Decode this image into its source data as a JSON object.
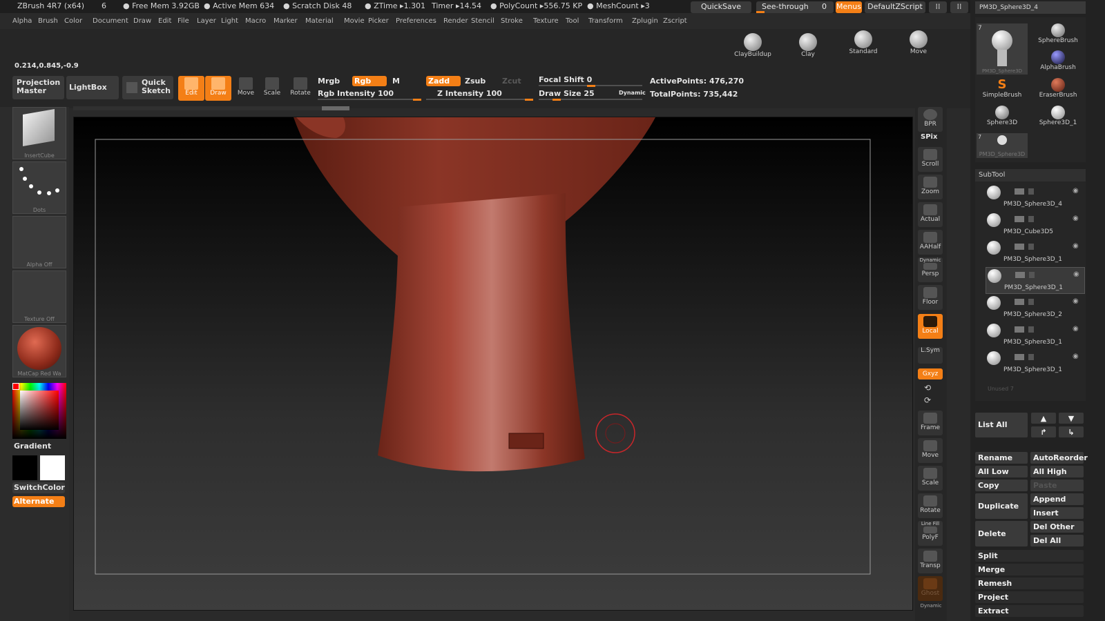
{
  "title_bar": {
    "app": "ZBrush 4R7 (x64)",
    "num": "6",
    "free_mem": "● Free Mem 3.92GB",
    "active_mem": "● Active Mem 634",
    "scratch": "● Scratch Disk 48",
    "ztime": "● ZTime ▸1.301",
    "timer": "Timer ▸14.54",
    "polycount": "● PolyCount ▸556.75 KP",
    "meshcount": "● MeshCount ▸3",
    "quicksave": "QuickSave",
    "see_through": "See-through",
    "see_through_val": "0",
    "menus": "Menus",
    "default_zscript": "DefaultZScript"
  },
  "menu_items": [
    "Alpha",
    "Brush",
    "Color",
    "Document",
    "Draw",
    "Edit",
    "File",
    "Layer",
    "Light",
    "Macro",
    "Marker",
    "Material",
    "Movie",
    "Picker",
    "Preferences",
    "Render",
    "Stencil",
    "Stroke",
    "Texture",
    "Tool",
    "Transform",
    "Zplugin",
    "Zscript"
  ],
  "shelf": {
    "coords": "0.214,0.845,-0.9",
    "projection_master": [
      "Projection",
      "Master"
    ],
    "lightbox": "LightBox",
    "quick_sketch": [
      "Quick",
      "Sketch"
    ],
    "edit": "Edit",
    "draw": "Draw",
    "move": "Move",
    "scale": "Scale",
    "rotate": "Rotate",
    "mrgb": "Mrgb",
    "rgb": "Rgb",
    "m": "M",
    "rgb_intensity": "Rgb  Intensity 100",
    "zadd": "Zadd",
    "zsub": "Zsub",
    "zcut": "Zcut",
    "z_intensity": "Z  Intensity 100",
    "focal_shift": "Focal  Shift 0",
    "draw_size": "Draw  Size 25",
    "dynamic": "Dynamic",
    "active_points": "ActivePoints: 476,270",
    "total_points": "TotalPoints: 735,442",
    "brushes": [
      "ClayBuildup",
      "Clay",
      "Standard",
      "Move"
    ]
  },
  "left_shelf": {
    "insert_cube": "InsertCube",
    "dots": "Dots",
    "alpha_off": "Alpha  Off",
    "texture_off": "Texture  Off",
    "matcap": "MatCap  Red  Wa",
    "gradient": "Gradient",
    "switch_color": "SwitchColor",
    "alternate": "Alternate"
  },
  "right_tools": {
    "bpr": "BPR",
    "spix": "SPix",
    "scroll": "Scroll",
    "zoom": "Zoom",
    "actual": "Actual",
    "aahalf": "AAHalf",
    "dynamic": "Dynamic",
    "persp": "Persp",
    "floor": "Floor",
    "local": "Local",
    "lsym": "L.Sym",
    "xyz": "Gxyz",
    "frame": "Frame",
    "move": "Move",
    "scale": "Scale",
    "rotate": "Rotate",
    "line_fill": "Line Fill",
    "polyf": "PolyF",
    "transp": "Transp",
    "ghost": "Ghost",
    "solo_dynamic": "Dynamic"
  },
  "tool_palette": {
    "top_label": "PM3D_Sphere3D_4",
    "count": "7",
    "items": [
      {
        "label": "PM3D_Sphere3D"
      },
      {
        "label": "SphereBrush"
      },
      {
        "label": "AlphaBrush"
      },
      {
        "label": "SimpleBrush"
      },
      {
        "label": "EraserBrush"
      },
      {
        "label": "Sphere3D"
      },
      {
        "label": "Sphere3D_1"
      },
      {
        "label": "PM3D_Sphere3D"
      }
    ],
    "bottom_count": "7"
  },
  "subtool": {
    "header": "SubTool",
    "items": [
      "PM3D_Sphere3D_4",
      "PM3D_Cube3D5",
      "PM3D_Sphere3D_1",
      "PM3D_Sphere3D_1",
      "PM3D_Sphere3D_2",
      "PM3D_Sphere3D_1",
      "PM3D_Sphere3D_1"
    ],
    "unused": "Unused 7",
    "list_all": "List  All",
    "rename": "Rename",
    "autoreorder": "AutoReorder",
    "all_low": "All  Low",
    "all_high": "All  High",
    "copy": "Copy",
    "paste": "Paste",
    "duplicate": "Duplicate",
    "append": "Append",
    "insert": "Insert",
    "delete": "Delete",
    "del_other": "Del  Other",
    "del_all": "Del  All",
    "split": "Split",
    "merge": "Merge",
    "remesh": "Remesh",
    "project": "Project",
    "extract": "Extract"
  },
  "colors": {
    "accent": "#f47f16",
    "model": "#9c3b2a",
    "bg": "#2a2a2a"
  }
}
